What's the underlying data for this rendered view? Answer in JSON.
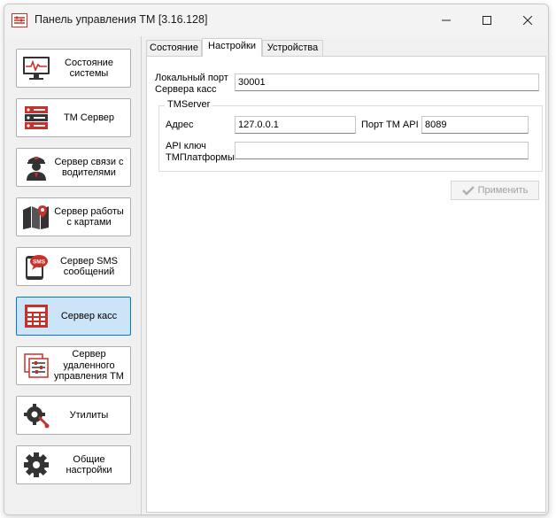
{
  "window": {
    "title": "Панель управления ТМ [3.16.128]",
    "controls": {
      "minimize": "minimize-icon",
      "maximize": "maximize-icon",
      "close": "close-icon"
    }
  },
  "sidebar": {
    "items": [
      {
        "label": "Состояние системы",
        "icon": "monitor-pulse-icon",
        "active": false
      },
      {
        "label": "ТМ Сервер",
        "icon": "server-rack-icon",
        "active": false
      },
      {
        "label": "Сервер связи с водителями",
        "icon": "driver-icon",
        "active": false
      },
      {
        "label": "Сервер работы с картами",
        "icon": "map-pin-icon",
        "active": false
      },
      {
        "label": "Сервер SMS сообщений",
        "icon": "sms-phone-icon",
        "active": false
      },
      {
        "label": "Сервер касс",
        "icon": "cash-register-icon",
        "active": true
      },
      {
        "label": "Сервер удаленного управления ТМ",
        "icon": "remote-control-icon",
        "active": false
      },
      {
        "label": "Утилиты",
        "icon": "wrench-gear-icon",
        "active": false
      },
      {
        "label": "Общие настройки",
        "icon": "gear-icon",
        "active": false
      }
    ]
  },
  "tabs": [
    {
      "label": "Состояние",
      "active": false
    },
    {
      "label": "Настройки",
      "active": true
    },
    {
      "label": "Устройства",
      "active": false
    }
  ],
  "settings": {
    "local_port_label": "Локальный порт Сервера касс",
    "local_port_value": "30001",
    "group_title": "TMServer",
    "address_label": "Адрес",
    "address_value": "127.0.0.1",
    "tm_api_port_label": "Порт ТМ API",
    "tm_api_port_value": "8089",
    "api_key_label": "API ключ ТМПлатформы",
    "api_key_value": "",
    "apply_label": "Применить"
  },
  "colors": {
    "accent": "#0078d7",
    "active_bg": "#cce4f7",
    "icon_red": "#c8302a",
    "icon_dark": "#333333"
  }
}
